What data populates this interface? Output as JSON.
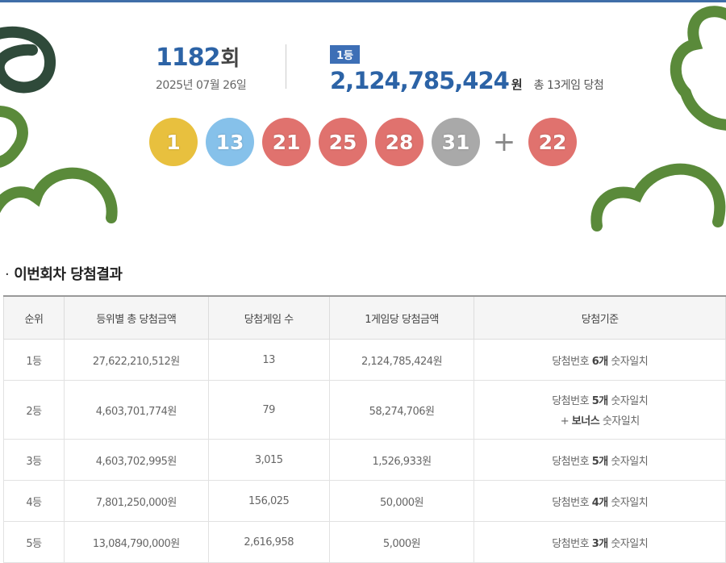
{
  "colors": {
    "accent": "#2c63a6",
    "deco_green": "#5a8a3a",
    "deco_dark": "#2f4a3a"
  },
  "draw": {
    "round_number": "1182",
    "round_unit": "회",
    "date": "2025년 07월 26일",
    "first_prize": {
      "badge": "1등",
      "amount": "2,124,785,424",
      "unit": "원",
      "games": "총 13게임 당첨"
    },
    "balls": [
      {
        "number": "1",
        "color": "#e8c03e"
      },
      {
        "number": "13",
        "color": "#86c1ea"
      },
      {
        "number": "21",
        "color": "#e0726e"
      },
      {
        "number": "25",
        "color": "#e0726e"
      },
      {
        "number": "28",
        "color": "#e0726e"
      },
      {
        "number": "31",
        "color": "#a9a9a9"
      }
    ],
    "plus": "+",
    "bonus": {
      "number": "22",
      "color": "#e0726e"
    }
  },
  "results": {
    "title": "이번회차 당첨결과",
    "headers": [
      "순위",
      "등위별 총 당첨금액",
      "당첨게임 수",
      "1게임당 당첨금액",
      "당첨기준"
    ],
    "rows": [
      {
        "rank": "1등",
        "total": "27,622,210,512원",
        "games": "13",
        "per_game": "2,124,785,424원",
        "crit_pre": "당첨번호 ",
        "crit_bold": "6개",
        "crit_post": " 숫자일치",
        "crit_line2_pre": "",
        "crit_line2_bold": "",
        "crit_line2_post": ""
      },
      {
        "rank": "2등",
        "total": "4,603,701,774원",
        "games": "79",
        "per_game": "58,274,706원",
        "crit_pre": "당첨번호 ",
        "crit_bold": "5개",
        "crit_post": " 숫자일치",
        "crit_line2_pre": "+ ",
        "crit_line2_bold": "보너스",
        "crit_line2_post": " 숫자일치"
      },
      {
        "rank": "3등",
        "total": "4,603,702,995원",
        "games": "3,015",
        "per_game": "1,526,933원",
        "crit_pre": "당첨번호 ",
        "crit_bold": "5개",
        "crit_post": " 숫자일치",
        "crit_line2_pre": "",
        "crit_line2_bold": "",
        "crit_line2_post": ""
      },
      {
        "rank": "4등",
        "total": "7,801,250,000원",
        "games": "156,025",
        "per_game": "50,000원",
        "crit_pre": "당첨번호 ",
        "crit_bold": "4개",
        "crit_post": " 숫자일치",
        "crit_line2_pre": "",
        "crit_line2_bold": "",
        "crit_line2_post": ""
      },
      {
        "rank": "5등",
        "total": "13,084,790,000원",
        "games": "2,616,958",
        "per_game": "5,000원",
        "crit_pre": "당첨번호 ",
        "crit_bold": "3개",
        "crit_post": " 숫자일치",
        "crit_line2_pre": "",
        "crit_line2_bold": "",
        "crit_line2_post": ""
      }
    ]
  }
}
